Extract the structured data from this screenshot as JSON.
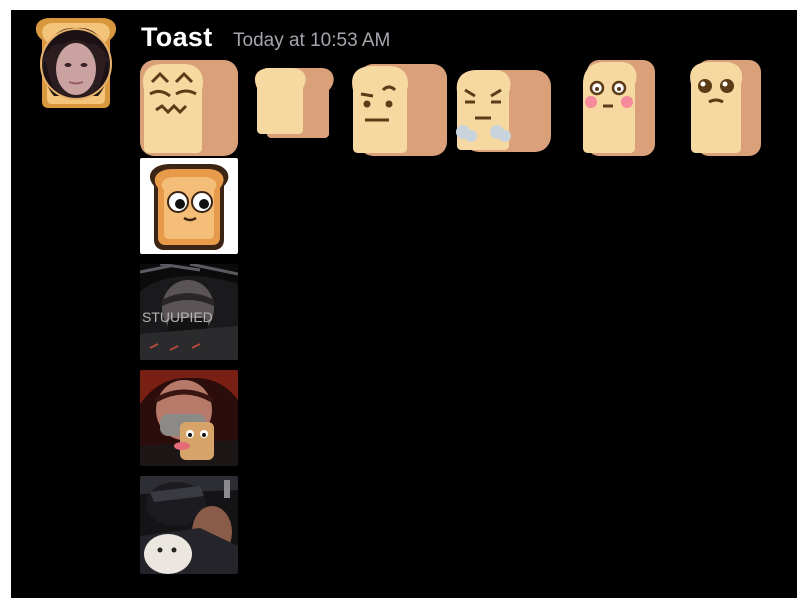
{
  "message": {
    "username": "Toast",
    "timestamp": "Today at 10:53 AM",
    "avatar_icon": "toast-frame-avatar-icon"
  },
  "colors": {
    "background": "#000000",
    "username": "#ffffff",
    "timestamp": "#a3a6ad",
    "toast_crust": "#d9a07a",
    "toast_bread": "#f6d8a1",
    "toast_face": "#5c3b17"
  },
  "emoji_row": [
    {
      "name": "toast-sweating-emoji"
    },
    {
      "name": "toast-plain-emoji"
    },
    {
      "name": "toast-suspicious-emoji"
    },
    {
      "name": "toast-angry-steam-emoji"
    },
    {
      "name": "toast-blushing-emoji"
    },
    {
      "name": "toast-pleading-emoji"
    }
  ],
  "attachments": [
    {
      "name": "googly-eyes-toast-image"
    },
    {
      "name": "masked-person-photo-1",
      "visible_text": "STUUPIED"
    },
    {
      "name": "masked-person-toast-photo"
    },
    {
      "name": "masked-person-plush-photo"
    }
  ]
}
